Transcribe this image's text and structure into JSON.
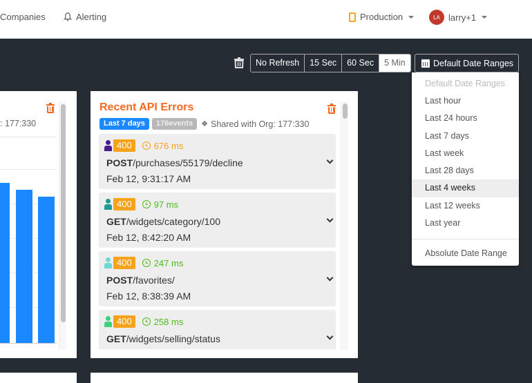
{
  "nav": {
    "companies": "Companies",
    "alerting": "Alerting",
    "environment": "Production",
    "user_initials": "LA",
    "user_name": "larry+1"
  },
  "toolbar": {
    "refresh_options": [
      {
        "label": "No Refresh",
        "active": false
      },
      {
        "label": "15 Sec",
        "active": false
      },
      {
        "label": "60 Sec",
        "active": false
      },
      {
        "label": "5 Min",
        "active": true
      }
    ],
    "date_range_label": "Default Date Ranges"
  },
  "date_dropdown": {
    "header": "Default Date Ranges",
    "items": [
      "Last hour",
      "Last 24 hours",
      "Last 7 days",
      "Last week",
      "Last 28 days",
      "Last 4 weeks",
      "Last 12 weeks",
      "Last year"
    ],
    "active": "Last 4 weeks",
    "absolute": "Absolute Date Range"
  },
  "left_card": {
    "shared_fragment": ": 177:330"
  },
  "api_errors_card": {
    "title": "Recent API Errors",
    "range_badge": "Last 7 days",
    "events_badge": "176events",
    "shared": "Shared with Org: 177:330",
    "errors": [
      {
        "user_color": "#4a1a8c",
        "status": "400",
        "duration": "676 ms",
        "duration_color": "#f7a21b",
        "method": "POST",
        "path": "/purchases/55179/decline",
        "date": "Feb 12, 9:31:17 AM"
      },
      {
        "user_color": "#1e9a96",
        "status": "400",
        "duration": "97 ms",
        "duration_color": "#4cbb17",
        "method": "GET",
        "path": "/widgets/category/100",
        "date": "Feb 12, 8:42:20 AM"
      },
      {
        "user_color": "#6fd8d4",
        "status": "400",
        "duration": "247 ms",
        "duration_color": "#4cbb17",
        "method": "POST",
        "path": "/favorites/",
        "date": "Feb 12, 8:38:39 AM"
      },
      {
        "user_color": "#3ed07a",
        "status": "400",
        "duration": "258 ms",
        "duration_color": "#4cbb17",
        "method": "GET",
        "path": "/widgets/selling/status",
        "date": ""
      }
    ]
  },
  "colors": {
    "accent_orange": "#f56a1e",
    "blue": "#1a88ff",
    "status_badge": "#f7a21b"
  }
}
